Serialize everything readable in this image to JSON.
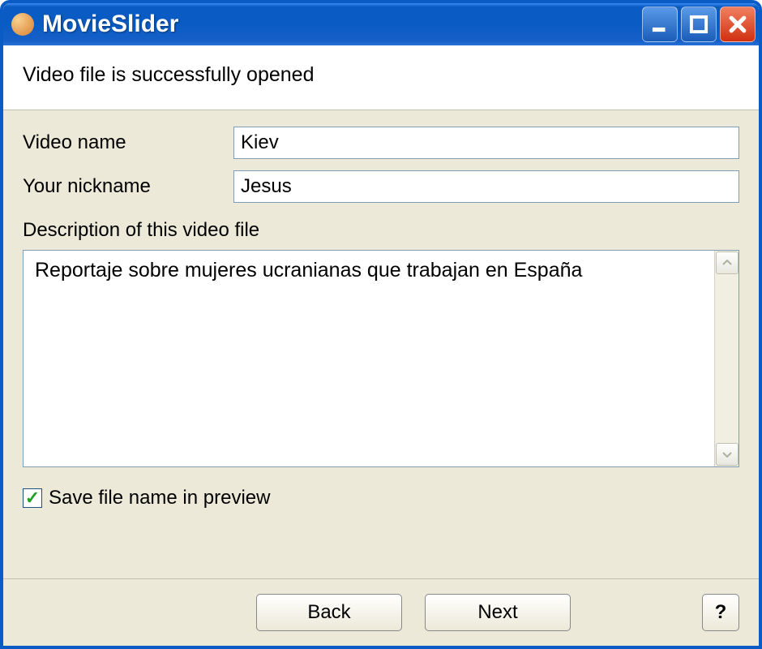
{
  "window": {
    "title": "MovieSlider"
  },
  "header": {
    "status": "Video file is successfully opened"
  },
  "form": {
    "video_name_label": "Video name",
    "video_name_value": "Kiev",
    "nickname_label": "Your nickname",
    "nickname_value": "Jesus",
    "description_label": "Description of this video file",
    "description_value": "Reportaje sobre mujeres ucranianas que trabajan en España"
  },
  "checkbox": {
    "label": "Save file name in preview",
    "checked": true
  },
  "footer": {
    "back_label": "Back",
    "next_label": "Next",
    "help_label": "?"
  }
}
